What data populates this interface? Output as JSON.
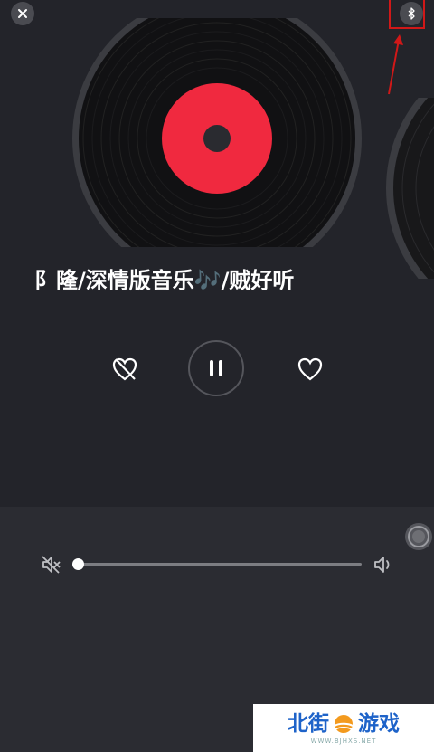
{
  "player": {
    "song_title": "阝隆/深情版音乐🎶/贼好听",
    "volume": 0.02,
    "playing": true
  },
  "icons": {
    "close": "close-icon",
    "bluetooth": "bluetooth-icon",
    "dislike": "dislike-heart-icon",
    "pause": "pause-icon",
    "like": "heart-icon",
    "mute": "volume-mute-icon",
    "volume": "volume-icon",
    "floating": "floating-ball-icon"
  },
  "colors": {
    "background": "#23242a",
    "record_label": "#f0293f",
    "annotation": "#d01818"
  },
  "watermark": {
    "left_text": "北街",
    "right_text": "游戏",
    "url": "WWW.BJHXS.NET"
  }
}
